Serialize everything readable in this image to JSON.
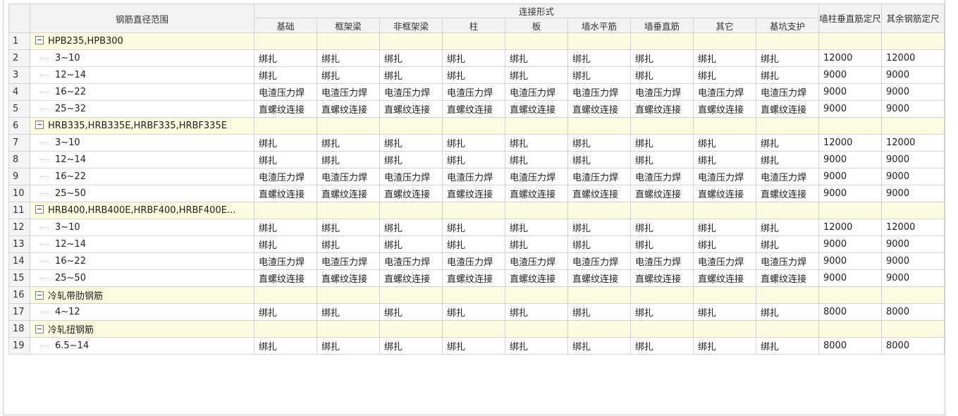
{
  "header": {
    "range_label": "钢筋直径范围",
    "connection_group": "连接形式",
    "columns": [
      "基础",
      "框架梁",
      "非框架梁",
      "柱",
      "板",
      "墙水平筋",
      "墙垂直筋",
      "其它",
      "基坑支护"
    ],
    "wall_col_length": "墙柱垂直筋定尺",
    "other_length": "其余钢筋定尺"
  },
  "rows": [
    {
      "num": "1",
      "type": "group",
      "label": "HPB235,HPB300"
    },
    {
      "num": "2",
      "type": "item",
      "label": "3~10",
      "conn": [
        "绑扎",
        "绑扎",
        "绑扎",
        "绑扎",
        "绑扎",
        "绑扎",
        "绑扎",
        "绑扎",
        "绑扎"
      ],
      "wall_len": "12000",
      "other_len": "12000"
    },
    {
      "num": "3",
      "type": "item",
      "label": "12~14",
      "conn": [
        "绑扎",
        "绑扎",
        "绑扎",
        "绑扎",
        "绑扎",
        "绑扎",
        "绑扎",
        "绑扎",
        "绑扎"
      ],
      "wall_len": "9000",
      "other_len": "9000"
    },
    {
      "num": "4",
      "type": "item",
      "label": "16~22",
      "conn": [
        "电渣压力焊",
        "电渣压力焊",
        "电渣压力焊",
        "电渣压力焊",
        "电渣压力焊",
        "电渣压力焊",
        "电渣压力焊",
        "电渣压力焊",
        "电渣压力焊"
      ],
      "wall_len": "9000",
      "other_len": "9000"
    },
    {
      "num": "5",
      "type": "item",
      "label": "25~32",
      "conn": [
        "直螺纹连接",
        "直螺纹连接",
        "直螺纹连接",
        "直螺纹连接",
        "直螺纹连接",
        "直螺纹连接",
        "直螺纹连接",
        "直螺纹连接",
        "直螺纹连接"
      ],
      "wall_len": "9000",
      "other_len": "9000"
    },
    {
      "num": "6",
      "type": "group",
      "label": "HRB335,HRB335E,HRBF335,HRBF335E"
    },
    {
      "num": "7",
      "type": "item",
      "label": "3~10",
      "conn": [
        "绑扎",
        "绑扎",
        "绑扎",
        "绑扎",
        "绑扎",
        "绑扎",
        "绑扎",
        "绑扎",
        "绑扎"
      ],
      "wall_len": "12000",
      "other_len": "12000"
    },
    {
      "num": "8",
      "type": "item",
      "label": "12~14",
      "conn": [
        "绑扎",
        "绑扎",
        "绑扎",
        "绑扎",
        "绑扎",
        "绑扎",
        "绑扎",
        "绑扎",
        "绑扎"
      ],
      "wall_len": "9000",
      "other_len": "9000"
    },
    {
      "num": "9",
      "type": "item",
      "label": "16~22",
      "conn": [
        "电渣压力焊",
        "电渣压力焊",
        "电渣压力焊",
        "电渣压力焊",
        "电渣压力焊",
        "电渣压力焊",
        "电渣压力焊",
        "电渣压力焊",
        "电渣压力焊"
      ],
      "wall_len": "9000",
      "other_len": "9000"
    },
    {
      "num": "10",
      "type": "item",
      "label": "25~50",
      "conn": [
        "直螺纹连接",
        "直螺纹连接",
        "直螺纹连接",
        "直螺纹连接",
        "直螺纹连接",
        "直螺纹连接",
        "直螺纹连接",
        "直螺纹连接",
        "直螺纹连接"
      ],
      "wall_len": "9000",
      "other_len": "9000"
    },
    {
      "num": "11",
      "type": "group",
      "label": "HRB400,HRB400E,HRBF400,HRBF400E..."
    },
    {
      "num": "12",
      "type": "item",
      "label": "3~10",
      "conn": [
        "绑扎",
        "绑扎",
        "绑扎",
        "绑扎",
        "绑扎",
        "绑扎",
        "绑扎",
        "绑扎",
        "绑扎"
      ],
      "wall_len": "12000",
      "other_len": "12000"
    },
    {
      "num": "13",
      "type": "item",
      "label": "12~14",
      "conn": [
        "绑扎",
        "绑扎",
        "绑扎",
        "绑扎",
        "绑扎",
        "绑扎",
        "绑扎",
        "绑扎",
        "绑扎"
      ],
      "wall_len": "9000",
      "other_len": "9000"
    },
    {
      "num": "14",
      "type": "item",
      "label": "16~22",
      "conn": [
        "电渣压力焊",
        "电渣压力焊",
        "电渣压力焊",
        "电渣压力焊",
        "电渣压力焊",
        "电渣压力焊",
        "电渣压力焊",
        "电渣压力焊",
        "电渣压力焊"
      ],
      "wall_len": "9000",
      "other_len": "9000"
    },
    {
      "num": "15",
      "type": "item",
      "label": "25~50",
      "conn": [
        "直螺纹连接",
        "直螺纹连接",
        "直螺纹连接",
        "直螺纹连接",
        "直螺纹连接",
        "直螺纹连接",
        "直螺纹连接",
        "直螺纹连接",
        "直螺纹连接"
      ],
      "wall_len": "9000",
      "other_len": "9000"
    },
    {
      "num": "16",
      "type": "group",
      "label": "冷轧带肋钢筋"
    },
    {
      "num": "17",
      "type": "item",
      "label": "4~12",
      "conn": [
        "绑扎",
        "绑扎",
        "绑扎",
        "绑扎",
        "绑扎",
        "绑扎",
        "绑扎",
        "绑扎",
        "绑扎"
      ],
      "wall_len": "8000",
      "other_len": "8000"
    },
    {
      "num": "18",
      "type": "group",
      "label": "冷轧扭钢筋"
    },
    {
      "num": "19",
      "type": "item",
      "label": "6.5~14",
      "conn": [
        "绑扎",
        "绑扎",
        "绑扎",
        "绑扎",
        "绑扎",
        "绑扎",
        "绑扎",
        "绑扎",
        "绑扎"
      ],
      "wall_len": "8000",
      "other_len": "8000"
    }
  ],
  "colors": {
    "group_row_bg": "#fdfbe1",
    "header_bg": "#f2f2f2",
    "grid_line": "#d4d4d4"
  }
}
